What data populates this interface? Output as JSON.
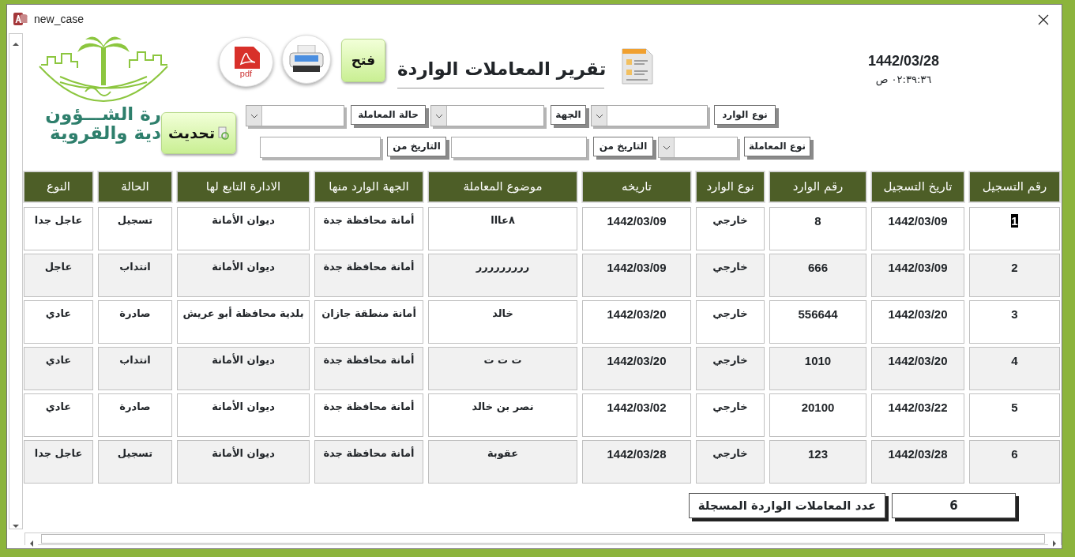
{
  "window": {
    "title": "new_case"
  },
  "logo": {
    "lines": [
      "رة الشـــؤون",
      "دية والقروية"
    ]
  },
  "toolbar": {
    "pdf_label": "pdf",
    "open_label": "فتح",
    "refresh_label": "تحديث"
  },
  "header": {
    "title": "تقرير المعاملات الواردة",
    "date": "1442/03/28",
    "time": "٠٢:٣٩:٣٦ ص"
  },
  "filter_rows": [
    {
      "fields": [
        {
          "label": "نوع الوارد",
          "kind": "combo"
        },
        {
          "label": "الجهة",
          "kind": "combo"
        },
        {
          "label": "حالة المعاملة",
          "kind": "combo"
        }
      ]
    },
    {
      "fields": [
        {
          "label": "نوع المعاملة",
          "kind": "combo"
        },
        {
          "label": "التاريخ من",
          "kind": "text"
        },
        {
          "label": "التاريخ من",
          "kind": "text"
        }
      ]
    }
  ],
  "table": {
    "columns": [
      "رقم التسجيل",
      "تاريخ التسجيل",
      "رقم الوارد",
      "نوع الوارد",
      "تاريخه",
      "موضوع المعاملة",
      "الجهة الوارد منها",
      "الادارة التابع لها",
      "الحالة",
      "النوع"
    ],
    "rows": [
      {
        "selected": true,
        "cells": [
          "1",
          "1442/03/09",
          "8",
          "خارجي",
          "1442/03/09",
          "٨عااا",
          "أمانة محافظة جدة",
          "ديوان الأمانة",
          "تسجيل",
          "عاجل جدا"
        ]
      },
      {
        "selected": false,
        "cells": [
          "2",
          "1442/03/09",
          "666",
          "خارجي",
          "1442/03/09",
          "ررررررررر",
          "أمانة محافظة جدة",
          "ديوان الأمانة",
          "انتداب",
          "عاجل"
        ]
      },
      {
        "selected": false,
        "cells": [
          "3",
          "1442/03/20",
          "556644",
          "خارجي",
          "1442/03/20",
          "خالد",
          "أمانة منطقة جازان",
          "بلدية محافظة أبو عريش",
          "صادرة",
          "عادي"
        ]
      },
      {
        "selected": false,
        "cells": [
          "4",
          "1442/03/20",
          "1010",
          "خارجي",
          "1442/03/20",
          "ت ت ت",
          "أمانة محافظة جدة",
          "ديوان الأمانة",
          "انتداب",
          "عادي"
        ]
      },
      {
        "selected": false,
        "cells": [
          "5",
          "1442/03/22",
          "20100",
          "خارجي",
          "1442/03/02",
          "نصر بن خالد",
          "أمانة محافظة جدة",
          "ديوان الأمانة",
          "صادرة",
          "عادي"
        ]
      },
      {
        "selected": false,
        "cells": [
          "6",
          "1442/03/28",
          "123",
          "خارجي",
          "1442/03/28",
          "عقوبة",
          "أمانة محافظة جدة",
          "ديوان الأمانة",
          "تسجيل",
          "عاجل جدا"
        ]
      }
    ]
  },
  "summary": {
    "label": "عدد المعاملات الواردة المسجلة",
    "value": "6"
  }
}
